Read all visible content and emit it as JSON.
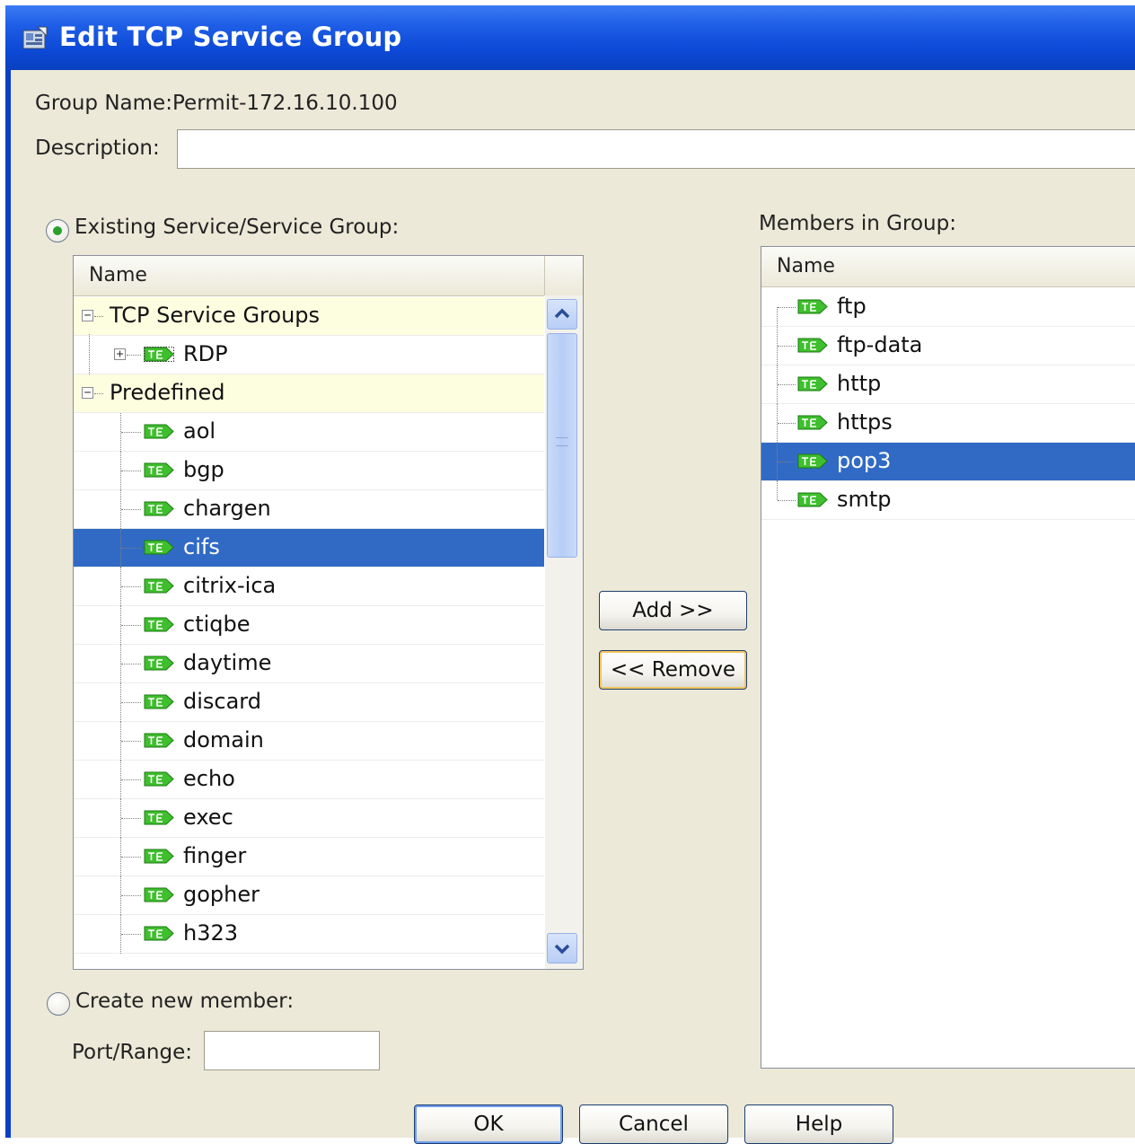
{
  "window": {
    "title": "Edit TCP Service Group"
  },
  "form": {
    "group_name_label": "Group Name:",
    "group_name_value": "Permit-172.16.10.100",
    "description_label": "Description:",
    "description_value": ""
  },
  "existing": {
    "radio_label": "Existing Service/Service Group:",
    "selected": true,
    "column_header": "Name",
    "tree": [
      {
        "label": "TCP Service Groups",
        "type": "group",
        "expander": "−"
      },
      {
        "label": "RDP",
        "type": "item",
        "expander": "+"
      },
      {
        "label": "Predefined",
        "type": "group",
        "expander": "−"
      },
      {
        "label": "aol",
        "type": "item"
      },
      {
        "label": "bgp",
        "type": "item"
      },
      {
        "label": "chargen",
        "type": "item"
      },
      {
        "label": "cifs",
        "type": "item",
        "selected": true
      },
      {
        "label": "citrix-ica",
        "type": "item"
      },
      {
        "label": "ctiqbe",
        "type": "item"
      },
      {
        "label": "daytime",
        "type": "item"
      },
      {
        "label": "discard",
        "type": "item"
      },
      {
        "label": "domain",
        "type": "item"
      },
      {
        "label": "echo",
        "type": "item"
      },
      {
        "label": "exec",
        "type": "item"
      },
      {
        "label": "finger",
        "type": "item"
      },
      {
        "label": "gopher",
        "type": "item"
      },
      {
        "label": "h323",
        "type": "item"
      }
    ]
  },
  "members": {
    "label": "Members in Group:",
    "column_header": "Name",
    "items": [
      {
        "label": "ftp"
      },
      {
        "label": "ftp-data"
      },
      {
        "label": "http"
      },
      {
        "label": "https"
      },
      {
        "label": "pop3",
        "selected": true
      },
      {
        "label": "smtp"
      }
    ]
  },
  "create_new": {
    "radio_label": "Create new member:",
    "selected": false,
    "port_label": "Port/Range:",
    "port_value": ""
  },
  "buttons": {
    "add": "Add >>",
    "remove": "<< Remove",
    "ok": "OK",
    "cancel": "Cancel",
    "help": "Help"
  },
  "icons": {
    "title": "window-app-icon",
    "item": "tcp-service-icon",
    "expander_collapse": "tree-collapse-icon",
    "expander_expand": "tree-expand-icon"
  },
  "colors": {
    "titlebar": "#0c49d6",
    "client": "#ece9d8",
    "selection": "#316ac5",
    "group_row": "#fdfde0",
    "tcp_badge": "#3fbf2d"
  }
}
